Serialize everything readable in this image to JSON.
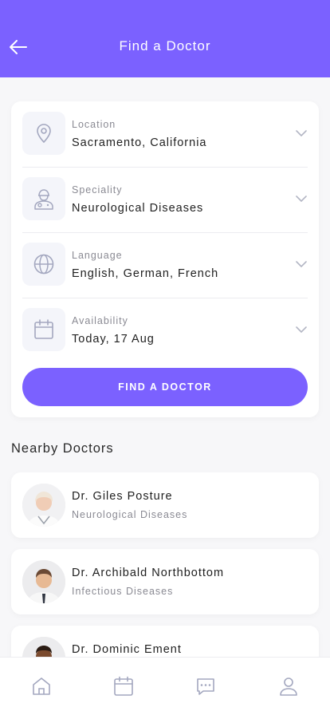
{
  "header": {
    "title": "Find a Doctor"
  },
  "filters": [
    {
      "label": "Location",
      "value": "Sacramento, California",
      "icon": "location-pin-icon"
    },
    {
      "label": "Speciality",
      "value": "Neurological Diseases",
      "icon": "doctor-icon"
    },
    {
      "label": "Language",
      "value": "English, German, French",
      "icon": "globe-icon"
    },
    {
      "label": "Availability",
      "value": "Today, 17 Aug",
      "icon": "calendar-icon"
    }
  ],
  "find_button": {
    "label": "FIND A DOCTOR"
  },
  "nearby": {
    "title": "Nearby Doctors",
    "doctors": [
      {
        "name": "Dr. Giles Posture",
        "speciality": "Neurological Diseases"
      },
      {
        "name": "Dr. Archibald Northbottom",
        "speciality": "Infectious Diseases"
      },
      {
        "name": "Dr. Dominic Ement",
        "speciality": ""
      }
    ]
  },
  "tabbar": {
    "items": [
      "home-icon",
      "calendar-icon",
      "chat-icon",
      "profile-icon"
    ]
  },
  "colors": {
    "accent": "#7b61ff",
    "background": "#f7f7f9",
    "icon": "#a3a7bf"
  }
}
